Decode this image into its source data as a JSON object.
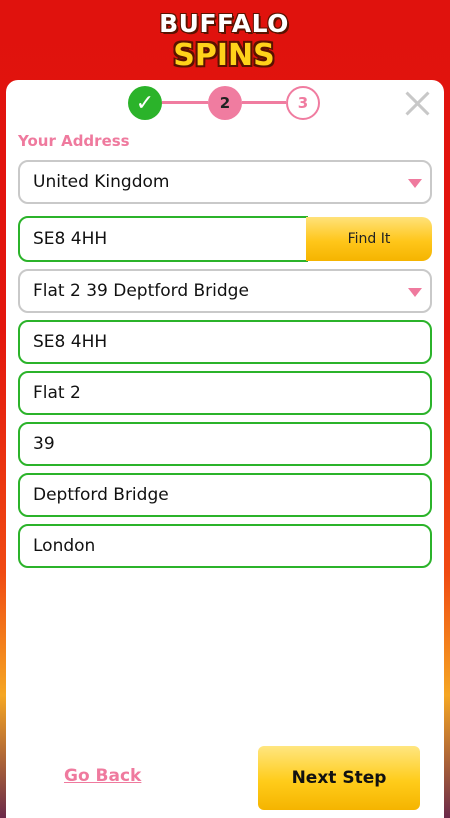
{
  "brand": {
    "line1": "BUFFALO",
    "line2": "SPINS"
  },
  "steps": {
    "step1_icon": "✓",
    "step2": "2",
    "step3": "3"
  },
  "form": {
    "section_label": "Your Address",
    "country": "United Kingdom",
    "postcode_search": "SE8 4HH",
    "find_button": "Find It",
    "address_select": "Flat 2 39 Deptford Bridge",
    "postcode": "SE8 4HH",
    "flat": "Flat 2",
    "house_number": "39",
    "street": "Deptford Bridge",
    "city": "London"
  },
  "footer": {
    "back_label": "Go Back",
    "next_label": "Next Step"
  },
  "colors": {
    "accent_pink": "#ef7a9e",
    "valid_green": "#2bb32a",
    "button_gold": "#ffc61a"
  },
  "icons": {
    "close": "close-icon",
    "check": "checkmark-icon",
    "caret": "chevron-down-icon"
  }
}
